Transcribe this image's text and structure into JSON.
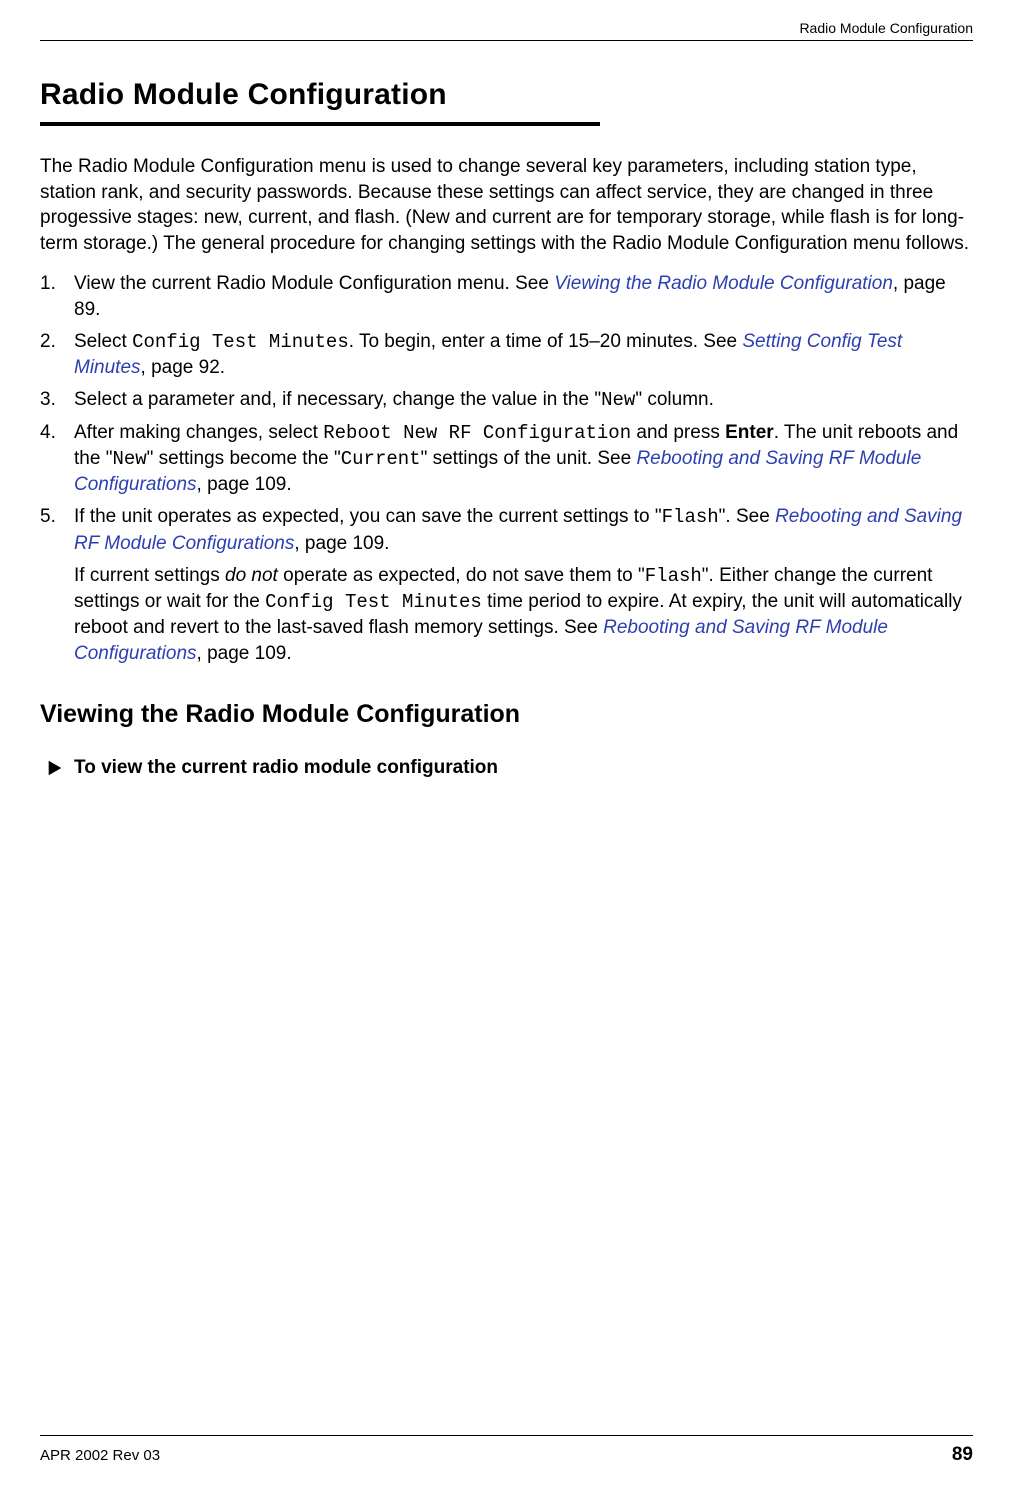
{
  "running_head": "Radio Module Configuration",
  "h1": "Radio Module Configuration",
  "intro": "The Radio Module Configuration menu is used to change several key parameters, including station type, station rank, and security passwords. Because these settings can affect service, they are changed in three progessive stages: new, current, and flash. (New and current are for temporary storage, while flash is for long-term storage.) The general procedure for changing settings with the Radio Module Configuration menu follows.",
  "steps": {
    "s1a": "View the current Radio Module Configuration menu. See ",
    "s1_link": "Viewing the Radio Module Configuration",
    "s1b": ", page 89.",
    "s2a": "Select ",
    "s2_mono": "Config Test Minutes",
    "s2b": ". To begin, enter a time of 15–20 minutes. See ",
    "s2_link": "Setting Config Test Minutes",
    "s2c": ", page 92.",
    "s3a": "Select a parameter and, if necessary, change the value in the \"",
    "s3_mono": "New",
    "s3b": "\" column.",
    "s4a": "After making changes, select ",
    "s4_mono1": "Reboot New RF Configuration",
    "s4b": " and press ",
    "s4_bold": "Enter",
    "s4c": ". The unit reboots and the \"",
    "s4_mono2": "New",
    "s4d": "\" settings become the \"",
    "s4_mono3": "Current",
    "s4e": "\" settings of the unit. See ",
    "s4_link": "Rebooting and Saving RF Module Configurations",
    "s4f": ", page 109.",
    "s5a": "If the unit operates as expected, you can save the current settings to \"",
    "s5_mono1": "Flash",
    "s5b": "\". See ",
    "s5_link": "Rebooting and Saving RF Module Configurations",
    "s5c": ", page 109."
  },
  "after": {
    "a": "If current settings ",
    "em": "do not",
    "b": " operate as expected, do not save them to \"",
    "mono1": "Flash",
    "c": "\". Either change the current settings or wait for the ",
    "mono2": "Config Test Minutes",
    "d": " time period to expire. At expiry, the unit will automatically reboot and revert to the last-saved flash memory settings. See ",
    "link": "Rebooting and Saving RF Module Configurations",
    "e": ", page 109."
  },
  "h2": "Viewing the Radio Module Configuration",
  "task": "To view the current radio module configuration",
  "footer": {
    "left": "APR 2002 Rev 03",
    "page": "89"
  },
  "nums": {
    "n1": "1.",
    "n2": "2.",
    "n3": "3.",
    "n4": "4.",
    "n5": "5."
  }
}
